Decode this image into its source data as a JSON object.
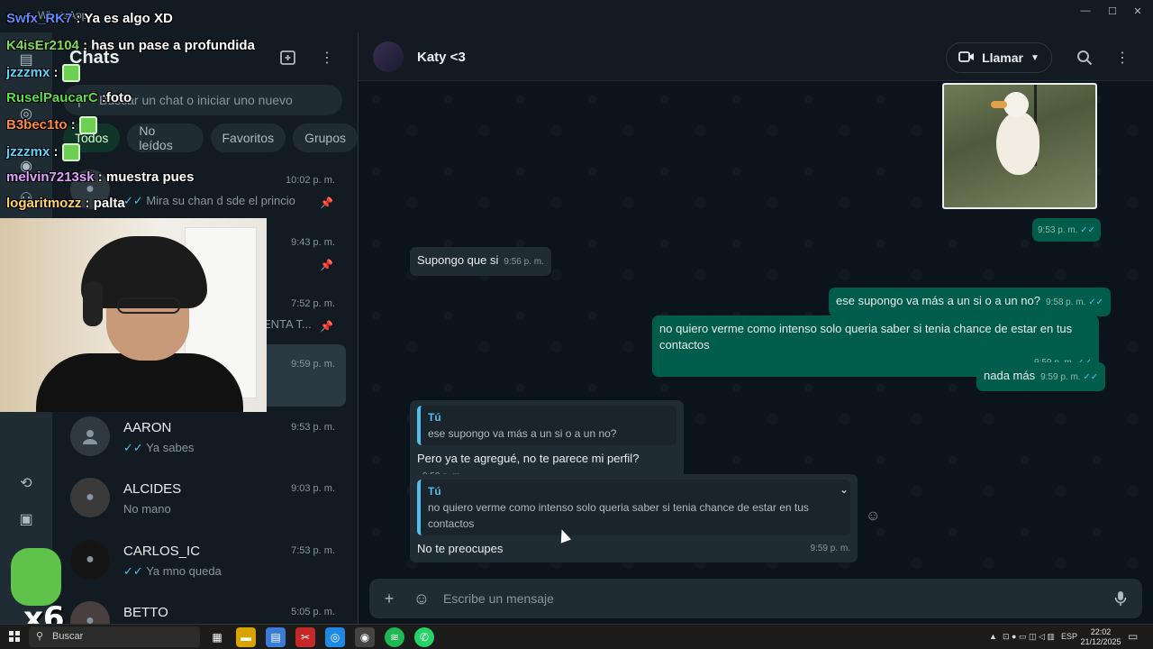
{
  "window": {
    "app_title": "WhatsApp"
  },
  "sidebar": {
    "title": "Chats",
    "search_placeholder": "Buscar un chat o iniciar uno nuevo",
    "filters": [
      "Todos",
      "No leídos",
      "Favoritos",
      "Grupos"
    ],
    "chats": [
      {
        "name": "",
        "time": "10:02 p. m.",
        "preview": "Mira su chan d sde el princio",
        "ticks": "✓✓",
        "pinned": true
      },
      {
        "name": "",
        "time": "9:43 p. m.",
        "preview": "",
        "ticks": "",
        "pinned": true
      },
      {
        "name": "",
        "time": "7:52 p. m.",
        "preview": "ENTA T...",
        "ticks": "",
        "pinned": true
      },
      {
        "name": "",
        "time": "9:59 p. m.",
        "preview": "",
        "ticks": "",
        "pinned": false
      },
      {
        "name": "AARON",
        "time": "9:53 p. m.",
        "preview": "Ya sabes",
        "ticks": "✓✓",
        "pinned": false
      },
      {
        "name": "ALCIDES",
        "time": "9:03 p. m.",
        "preview": "No mano",
        "ticks": "",
        "pinned": false
      },
      {
        "name": "CARLOS_IC",
        "time": "7:53 p. m.",
        "preview": "Ya mno queda",
        "ticks": "✓✓",
        "pinned": false
      },
      {
        "name": "BETTO",
        "time": "5:05 p. m.",
        "preview": "",
        "ticks": "",
        "pinned": false
      }
    ]
  },
  "chat": {
    "contact_name": "Katy <3",
    "call_label": "Llamar",
    "image_time": "9:53 p. m.",
    "messages": [
      {
        "dir": "in",
        "text": "Supongo que si",
        "time": "9:56 p. m."
      },
      {
        "dir": "out",
        "text": "ese supongo va más a un si o a un no?",
        "time": "9:58 p. m."
      },
      {
        "dir": "out",
        "text": "no quiero verme como intenso solo queria saber si tenia chance de estar en tus contactos",
        "time": "9:59 p. m."
      },
      {
        "dir": "out",
        "text": "nada más",
        "time": "9:59 p. m."
      },
      {
        "dir": "in",
        "quote_author": "Tú",
        "quote_text": "ese supongo va más a un si o a un no?",
        "text": "Pero ya te agregué, no te parece mi perfil?",
        "time": "9:59 p. m."
      },
      {
        "dir": "in",
        "quote_author": "Tú",
        "quote_text": "no quiero verme como intenso solo queria saber si tenia chance de estar en tus contactos",
        "text": "No te preocupes",
        "time": "9:59 p. m."
      }
    ],
    "composer_placeholder": "Escribe un mensaje"
  },
  "stream_overlay": {
    "lines": [
      {
        "user": "Swfx_RK7",
        "text": "Ya es algo XD",
        "color": "#5b8cff",
        "emote": false
      },
      {
        "user": "K4isEr2104",
        "text": "has un pase a profundida",
        "color": "#7ddc5a",
        "emote": false
      },
      {
        "user": "jzzzmx",
        "text": "",
        "color": "#5ad7ff",
        "emote": true
      },
      {
        "user": "RuselPaucarC",
        "text": "foto",
        "color": "#5be04a",
        "emote": false
      },
      {
        "user": "B3bec1to",
        "text": "",
        "color": "#ff8a3d",
        "emote": true
      },
      {
        "user": "jzzzmx",
        "text": "",
        "color": "#5ad7ff",
        "emote": true
      },
      {
        "user": "melvin7213sk",
        "text": "muestra pues",
        "color": "#e0a0ff",
        "emote": false
      },
      {
        "user": "logaritmozz",
        "text": "palta",
        "color": "#ffd36b",
        "emote": false
      }
    ],
    "badge_text": "x6"
  },
  "taskbar": {
    "search_label": "Buscar",
    "language": "ESP",
    "time": "22:02",
    "date": "21/12/2025"
  },
  "colors": {
    "accent_green": "#005c4b",
    "tick_blue": "#53bdeb"
  }
}
